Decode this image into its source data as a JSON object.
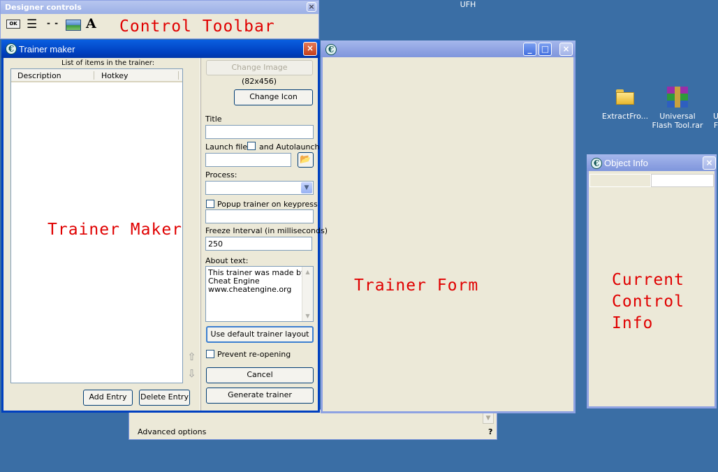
{
  "desktop": {
    "top_label": "UFH",
    "icons": [
      {
        "label": "ExtractFro...",
        "icon": "folder-icon"
      },
      {
        "label": "Universal\nFlash Tool.rar",
        "icon": "winrar-archive-icon"
      }
    ],
    "edge_labels": [
      "U",
      "F"
    ]
  },
  "designer_controls": {
    "title": "Designer controls",
    "close": "×",
    "tools": [
      {
        "name": "button-tool-icon",
        "glyph": "OK"
      },
      {
        "name": "list-tool-icon",
        "glyph": "☰"
      },
      {
        "name": "separator-tool-icon",
        "glyph": "- -"
      },
      {
        "name": "image-tool-icon",
        "glyph": ""
      },
      {
        "name": "label-tool-icon",
        "glyph": "A"
      }
    ],
    "annotation": "Control Toolbar"
  },
  "trainer_maker": {
    "title": "Trainer maker",
    "close": "×",
    "list_caption": "List of items in the trainer:",
    "columns": [
      "Description",
      "Hotkey"
    ],
    "annotation": "Trainer Maker",
    "add_entry": "Add Entry",
    "delete_entry": "Delete Entry",
    "up_arrow": "⇧",
    "down_arrow": "⇩",
    "change_image": "Change Image",
    "image_size": "(82x456)",
    "change_icon": "Change Icon",
    "title_label": "Title",
    "title_value": "",
    "launch_label": "Launch file:",
    "autolaunch_label": "and Autolaunch",
    "launch_value": "",
    "folder_glyph": "📂",
    "process_label": "Process:",
    "process_value": "",
    "popup_label": "Popup trainer on keypress",
    "popup_value": "",
    "freeze_label": "Freeze Interval (in milliseconds)",
    "freeze_value": "250",
    "about_label": "About text:",
    "about_text": "This trainer was made by\nCheat Engine\nwww.cheatengine.org",
    "default_layout": "Use default trainer layout",
    "prevent_label": "Prevent re-opening",
    "cancel": "Cancel",
    "generate": "Generate trainer"
  },
  "trainer_form": {
    "title": "",
    "annotation": "Trainer Form",
    "minimize": "_",
    "maximize": "□",
    "close": "×"
  },
  "object_info": {
    "title": "Object Info",
    "close": "×",
    "annotation": "Current\nControl\nInfo"
  },
  "background_window": {
    "advanced": "Advanced options",
    "help": "?"
  }
}
